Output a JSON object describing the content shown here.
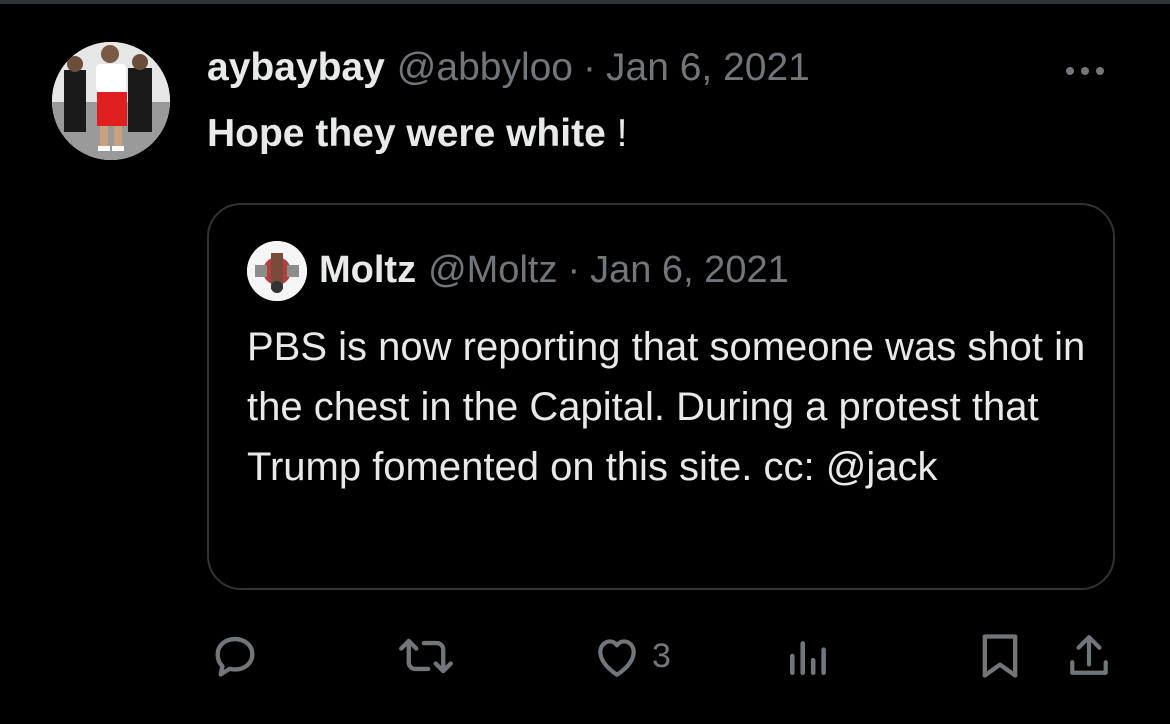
{
  "tweet": {
    "author_name": "aybaybay",
    "author_handle": "@abbyloo",
    "separator": "·",
    "date": "Jan 6, 2021",
    "text": "Hope they were white",
    "text_tail": " !",
    "more_icon": "more-horizontal-icon"
  },
  "quoted": {
    "author_name": "Moltz",
    "author_handle": "@Moltz",
    "separator": "·",
    "date": "Jan 6, 2021",
    "text": "PBS is now reporting that someone was shot in the chest in the Capital. During a protest that Trump fomented on this site. cc: @jack"
  },
  "actions": {
    "reply_icon": "reply-icon",
    "retweet_icon": "retweet-icon",
    "like_icon": "heart-icon",
    "like_count": "3",
    "views_icon": "views-chart-icon",
    "bookmark_icon": "bookmark-icon",
    "share_icon": "share-icon"
  },
  "colors": {
    "background": "#000000",
    "text": "#e7e9ea",
    "muted": "#71767b",
    "border": "#2f3336"
  }
}
